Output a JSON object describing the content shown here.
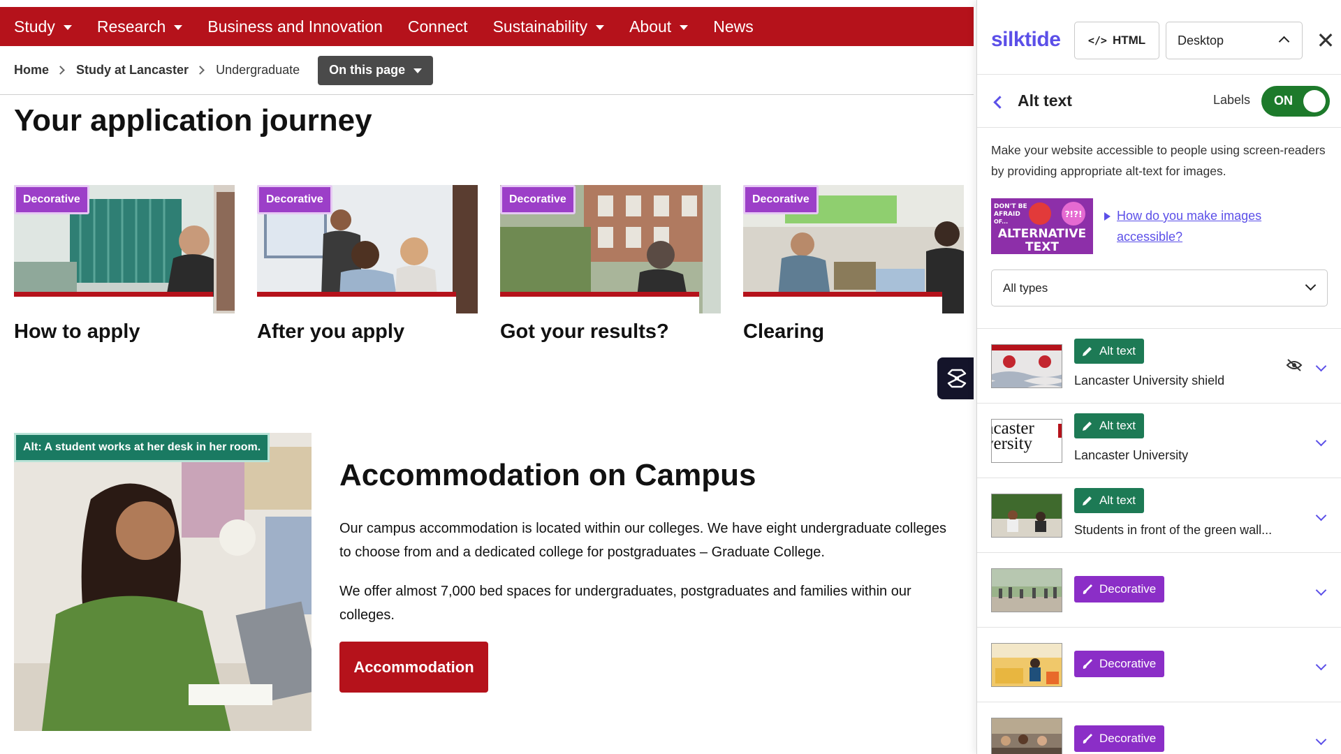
{
  "site": {
    "nav": [
      {
        "label": "Study",
        "has_menu": true
      },
      {
        "label": "Research",
        "has_menu": true
      },
      {
        "label": "Business and Innovation",
        "has_menu": false
      },
      {
        "label": "Connect",
        "has_menu": false
      },
      {
        "label": "Sustainability",
        "has_menu": true
      },
      {
        "label": "About",
        "has_menu": true
      },
      {
        "label": "News",
        "has_menu": false
      }
    ],
    "breadcrumb": [
      "Home",
      "Study at Lancaster",
      "Undergraduate"
    ],
    "on_this_page": "On this page",
    "journey_title": "Your application journey",
    "cards": [
      {
        "badge": "Decorative",
        "title": "How to apply"
      },
      {
        "badge": "Decorative",
        "title": "After you apply"
      },
      {
        "badge": "Decorative",
        "title": "Got your results?"
      },
      {
        "badge": "Decorative",
        "title": "Clearing"
      }
    ],
    "accommodation": {
      "alt_label": "Alt: A student works at her desk in her room.",
      "title": "Accommodation on Campus",
      "para1": "Our campus accommodation is located within our colleges. We have eight undergraduate colleges to choose from and a dedicated college for postgraduates – Graduate College.",
      "para2": "We offer almost 7,000 bed spaces for undergraduates, postgraduates and families within our colleges.",
      "button": "Accommodation"
    },
    "colors": {
      "brand_red": "#b5121b",
      "decorative_purple": "#9c3fc8",
      "alt_green": "#1a7a62"
    }
  },
  "panel": {
    "logo": "silktide",
    "html_button": "HTML",
    "device": "Desktop",
    "section_title": "Alt text",
    "labels_label": "Labels",
    "toggle": "ON",
    "description": "Make your website accessible to people using screen-readers by providing appropriate alt-text for images.",
    "poster_text": [
      "DON'T BE",
      "AFRAID",
      "OF...",
      "ALTERNATIVE",
      "TEXT",
      "?!?!"
    ],
    "help_link": "How do you make images accessible?",
    "type_filter": "All types",
    "items": [
      {
        "tag": "Alt text",
        "kind": "alt",
        "text": "Lancaster University shield",
        "hidden_icon": true
      },
      {
        "tag": "Alt text",
        "kind": "alt",
        "text": "Lancaster University",
        "thumb_text": [
          "ncaster",
          "versity"
        ]
      },
      {
        "tag": "Alt text",
        "kind": "alt",
        "text": "Students in front of the green wall..."
      },
      {
        "tag": "Decorative",
        "kind": "dec"
      },
      {
        "tag": "Decorative",
        "kind": "dec"
      },
      {
        "tag": "Decorative",
        "kind": "dec"
      }
    ],
    "colors": {
      "accent": "#5b4fe8",
      "toggle_on": "#1d7a2b",
      "alt_tag": "#1d7a55",
      "decorative_tag": "#8b2ec7"
    }
  }
}
